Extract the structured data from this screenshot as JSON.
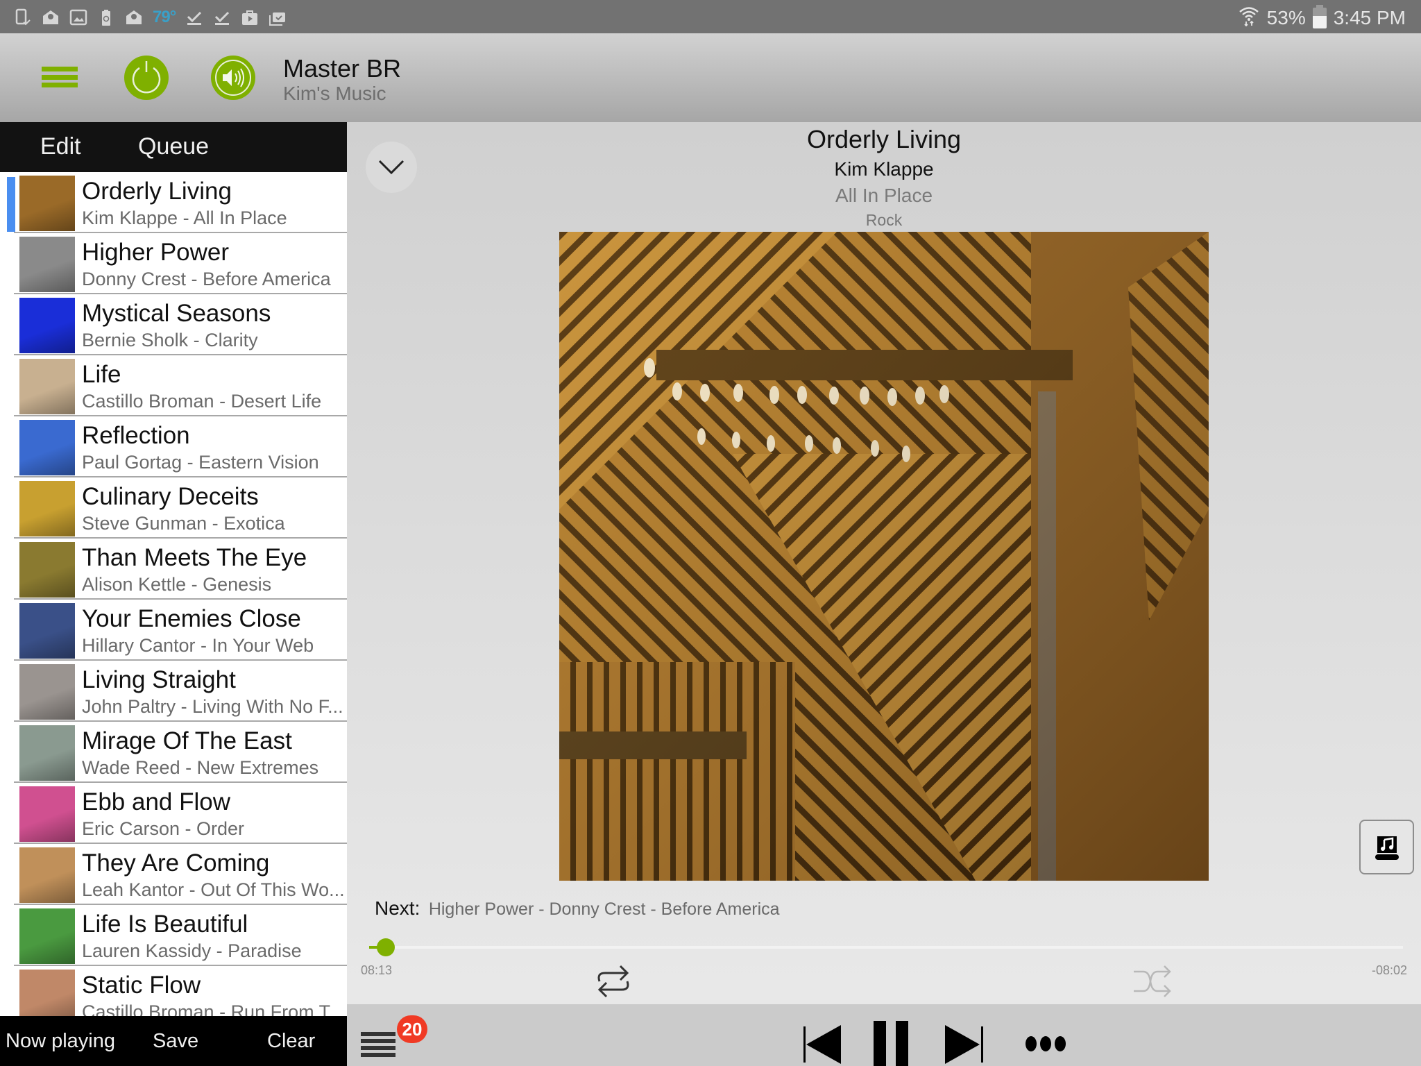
{
  "status_bar": {
    "notification_icons": [
      "tablet-check-icon",
      "email-open-icon",
      "image-icon",
      "battery-recycle-icon",
      "email-open-icon",
      "weather-temp",
      "download-done-icon",
      "download-done-icon",
      "play-store-icon",
      "briefcase-check-icon"
    ],
    "temperature": "79°",
    "battery_percent": "53%",
    "time": "3:45 PM"
  },
  "header": {
    "zone_name": "Master BR",
    "zone_source": "Kim's Music",
    "accent_color": "#7fb000"
  },
  "sidebar": {
    "tabs": [
      {
        "label": "Edit"
      },
      {
        "label": "Queue"
      }
    ],
    "queue": [
      {
        "title": "Orderly Living",
        "subtitle": "Kim Klappe - All In Place",
        "current": true,
        "thumb_color": "#9a6a28"
      },
      {
        "title": "Higher Power",
        "subtitle": "Donny Crest - Before America",
        "current": false,
        "thumb_color": "#8a8a8a"
      },
      {
        "title": "Mystical Seasons",
        "subtitle": "Bernie Sholk - Clarity",
        "current": false,
        "thumb_color": "#1a2ed8"
      },
      {
        "title": "Life",
        "subtitle": "Castillo Broman - Desert Life",
        "current": false,
        "thumb_color": "#c8b090"
      },
      {
        "title": "Reflection",
        "subtitle": "Paul Gortag - Eastern Vision",
        "current": false,
        "thumb_color": "#3a6ad0"
      },
      {
        "title": "Culinary Deceits",
        "subtitle": "Steve Gunman - Exotica",
        "current": false,
        "thumb_color": "#c8a030"
      },
      {
        "title": "Than Meets The Eye",
        "subtitle": "Alison Kettle - Genesis",
        "current": false,
        "thumb_color": "#8a7a30"
      },
      {
        "title": "Your Enemies Close",
        "subtitle": "Hillary Cantor - In Your Web",
        "current": false,
        "thumb_color": "#3a5088"
      },
      {
        "title": "Living Straight",
        "subtitle": "John Paltry - Living With No F...",
        "current": false,
        "thumb_color": "#9a9490"
      },
      {
        "title": "Mirage Of The East",
        "subtitle": "Wade Reed - New Extremes",
        "current": false,
        "thumb_color": "#8a9a90"
      },
      {
        "title": "Ebb and Flow",
        "subtitle": "Eric Carson - Order",
        "current": false,
        "thumb_color": "#d05090"
      },
      {
        "title": "They Are Coming",
        "subtitle": "Leah Kantor - Out Of This Wo...",
        "current": false,
        "thumb_color": "#c0905a"
      },
      {
        "title": "Life Is Beautiful",
        "subtitle": "Lauren Kassidy - Paradise",
        "current": false,
        "thumb_color": "#4a9a40"
      },
      {
        "title": "Static Flow",
        "subtitle": "Castillo Broman - Run From T",
        "current": false,
        "thumb_color": "#c08868"
      }
    ],
    "bottom_actions": {
      "now_playing": "Now playing",
      "save": "Save",
      "clear": "Clear"
    }
  },
  "now_playing": {
    "title": "Orderly Living",
    "artist": "Kim Klappe",
    "album": "All In Place",
    "genre": "Rock",
    "next_label": "Next:",
    "next_value": "Higher Power - Donny Crest - Before America",
    "elapsed": "08:13",
    "remaining": "-08:02",
    "progress_fraction": 0.016,
    "repeat_enabled": true,
    "shuffle_enabled": false,
    "queue_count": "20"
  }
}
